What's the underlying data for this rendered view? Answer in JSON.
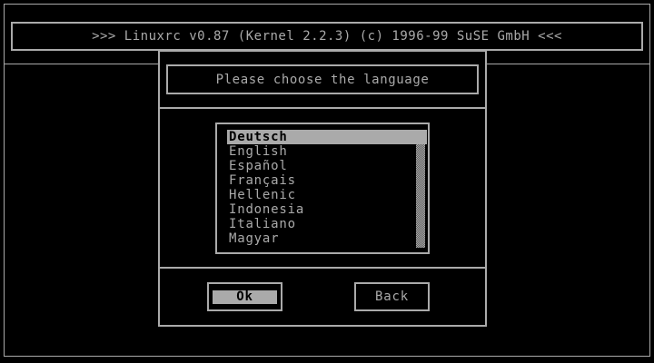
{
  "header": {
    "title": ">>> Linuxrc v0.87 (Kernel 2.2.3) (c) 1996-99 SuSE GmbH <<<"
  },
  "dialog": {
    "prompt": "Please choose the language",
    "languages": [
      "Deutsch",
      "English",
      "Español",
      "Français",
      "Hellenic",
      "Indonesia",
      "Italiano",
      "Magyar"
    ],
    "selected": "Deutsch",
    "ok_label": "Ok",
    "back_label": "Back"
  },
  "colors": {
    "background": "#000000",
    "foreground": "#aaaaaa",
    "highlight_text": "#000000"
  }
}
